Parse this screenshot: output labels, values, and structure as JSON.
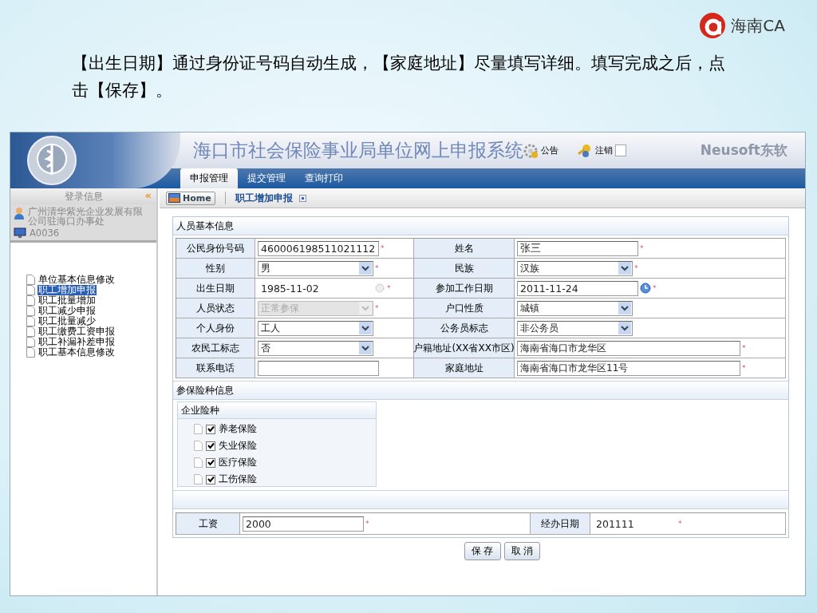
{
  "brand": {
    "name": "海南CA"
  },
  "caption": "【出生日期】通过身份证号码自动生成，【家庭地址】尽量填写详细。填写完成之后，点击【保存】。",
  "header": {
    "title": "海口市社会保险事业局单位网上申报系统",
    "notice": "公告",
    "logout": "注销",
    "vendor": "Neusoft东软"
  },
  "nav_tabs": [
    {
      "label": "申报管理",
      "selected": true
    },
    {
      "label": "提交管理",
      "selected": false
    },
    {
      "label": "查询打印",
      "selected": false
    }
  ],
  "sidebar": {
    "heading": "登录信息",
    "collapse": "«",
    "org": "广州清华紫光企业发展有限公司驻海口办事处",
    "user": "A0036",
    "items": [
      {
        "label": "单位基本信息修改",
        "selected": false
      },
      {
        "label": "职工增加申报",
        "selected": true
      },
      {
        "label": "职工批量增加",
        "selected": false
      },
      {
        "label": "职工减少申报",
        "selected": false
      },
      {
        "label": "职工批量减少",
        "selected": false
      },
      {
        "label": "职工缴费工资申报",
        "selected": false
      },
      {
        "label": "职工补漏补差申报",
        "selected": false
      },
      {
        "label": "职工基本信息修改",
        "selected": false
      }
    ]
  },
  "breadcrumb": {
    "home": "Home",
    "page": "职工增加申报"
  },
  "basic_info": {
    "title": "人员基本信息",
    "rows": [
      [
        {
          "label": "公民身份号码",
          "kind": "text",
          "value": "460006198511021112",
          "mark": "*",
          "disabled": false
        },
        {
          "label": "姓名",
          "kind": "text",
          "value": "张三",
          "mark": "*",
          "disabled": false
        }
      ],
      [
        {
          "label": "性别",
          "kind": "select",
          "value": "男",
          "mark": "*",
          "disabled": false
        },
        {
          "label": "民族",
          "kind": "select",
          "value": "汉族",
          "mark": "*",
          "disabled": false
        }
      ],
      [
        {
          "label": "出生日期",
          "kind": "date",
          "value": "1985-11-02",
          "mark": "*",
          "disabled": true
        },
        {
          "label": "参加工作日期",
          "kind": "date",
          "value": "2011-11-24",
          "mark": "*",
          "disabled": false
        }
      ],
      [
        {
          "label": "人员状态",
          "kind": "select",
          "value": "正常参保",
          "mark": "*",
          "disabled": true
        },
        {
          "label": "户口性质",
          "kind": "select",
          "value": "城镇",
          "disabled": false
        }
      ],
      [
        {
          "label": "个人身份",
          "kind": "select",
          "value": "工人",
          "disabled": false
        },
        {
          "label": "公务员标志",
          "kind": "select",
          "value": "非公务员",
          "disabled": false
        }
      ],
      [
        {
          "label": "农民工标志",
          "kind": "select",
          "value": "否",
          "disabled": false
        },
        {
          "label": "户籍地址(XX省XX市区)",
          "kind": "long-text",
          "value": "海南省海口市龙华区",
          "mark": "*",
          "disabled": false
        }
      ],
      [
        {
          "label": "联系电话",
          "kind": "text",
          "disabled": false
        },
        {
          "label": "家庭地址",
          "kind": "long-text",
          "value": "海南省海口市龙华区11号",
          "mark": "*",
          "disabled": false
        }
      ]
    ]
  },
  "insurance": {
    "title": "参保险种信息",
    "group": "企业险种",
    "items": [
      {
        "label": "养老保险",
        "checked": true
      },
      {
        "label": "失业保险",
        "checked": true
      },
      {
        "label": "医疗保险",
        "checked": true
      },
      {
        "label": "工伤保险",
        "checked": true
      }
    ]
  },
  "wage_row": [
    {
      "label": "工资",
      "kind": "text",
      "value": "2000",
      "mark": "*"
    },
    {
      "label": "经办日期",
      "kind": "plain",
      "value": "201111",
      "mark": "*"
    }
  ],
  "buttons": [
    "保 存",
    "取 消"
  ]
}
